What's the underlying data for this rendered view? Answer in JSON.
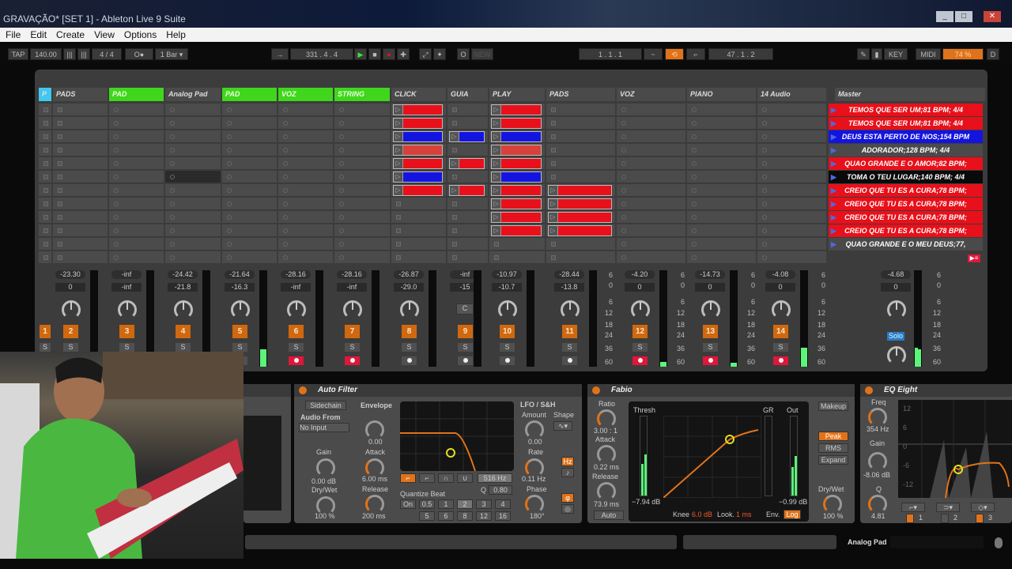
{
  "window": {
    "title": "GRAVAÇÃO*  [SET 1] - Ableton Live 9 Suite",
    "app_icon": "Live",
    "controls": [
      "_",
      "□",
      "✕"
    ]
  },
  "menu": [
    "File",
    "Edit",
    "Create",
    "View",
    "Options",
    "Help"
  ],
  "transport": {
    "tap": "TAP",
    "tempo": "140.00",
    "sig": "4  /  4",
    "metro": "O●",
    "quant": "1 Bar ▾",
    "follow": "→",
    "position": "331 .  4 .  4",
    "new": "NEW",
    "loop_start": "1 .  1 .  1",
    "loop_len": "47 .  1 .  2",
    "key": "KEY",
    "midi": "MIDI",
    "cpu": "74 %",
    "d": "D"
  },
  "tracks": [
    {
      "name": "P",
      "color": "#3fc8f0"
    },
    {
      "name": "PADS"
    },
    {
      "name": "PAD",
      "green": true
    },
    {
      "name": "Analog Pad"
    },
    {
      "name": "PAD",
      "green": true
    },
    {
      "name": "VOZ",
      "green": true
    },
    {
      "name": "STRING",
      "green": true
    },
    {
      "name": "CLICK"
    },
    {
      "name": "GUIA"
    },
    {
      "name": "PLAY"
    },
    {
      "name": "PADS"
    },
    {
      "name": "VOZ"
    },
    {
      "name": "PIANO"
    },
    {
      "name": "14 Audio"
    }
  ],
  "master_label": "Master",
  "clip_colors": {
    "r": "#e8101a",
    "b": "#1414e0",
    "l": "#d8403a"
  },
  "clips": {
    "7": [
      "r",
      "r",
      "b",
      "l",
      "r",
      "b",
      "r"
    ],
    "8": [
      "",
      "",
      "b",
      "",
      "r",
      "",
      "r"
    ],
    "9": [
      "r",
      "r",
      "b",
      "l",
      "r",
      "b",
      "r",
      "r",
      "r",
      "r"
    ],
    "10": [
      "",
      "",
      "",
      "",
      "",
      "",
      "r",
      "r",
      "r",
      "r"
    ]
  },
  "scenes": [
    {
      "name": "TEMOS QUE SER UM;81 BPM; 4/4",
      "color": "#e8101a"
    },
    {
      "name": "TEMOS QUE SER UM;81 BPM; 4/4",
      "color": "#e8101a"
    },
    {
      "name": "DEUS ESTA PERTO DE NOS;154 BPM",
      "color": "#1414e0"
    },
    {
      "name": "ADORADOR;128 BPM; 4/4",
      "color": "#4a4a4a"
    },
    {
      "name": "QUAO GRANDE E O AMOR;82 BPM;",
      "color": "#e8101a"
    },
    {
      "name": "TOMA O TEU LUGAR;140 BPM; 4/4",
      "color": "#0a0a0a"
    },
    {
      "name": "CREIO QUE TU ES A CURA;78 BPM;",
      "color": "#e8101a"
    },
    {
      "name": "CREIO QUE TU ES A CURA;78 BPM;",
      "color": "#e8101a"
    },
    {
      "name": "CREIO QUE TU ES A CURA;78 BPM;",
      "color": "#e8101a"
    },
    {
      "name": "CREIO QUE TU ES A CURA;78 BPM;",
      "color": "#e8101a"
    },
    {
      "name": "QUAO GRANDE  E O MEU DEUS;77,",
      "color": "#4a4a4a"
    }
  ],
  "mixer": [
    {
      "n": "1",
      "peak": "",
      "vol": "",
      "arm": false,
      "meter": 0
    },
    {
      "n": "2",
      "peak": "-23.30",
      "vol": "0",
      "arm": false,
      "meter": 0.1
    },
    {
      "n": "3",
      "peak": "-inf",
      "vol": "-inf",
      "arm": false,
      "meter": 0
    },
    {
      "n": "4",
      "peak": "-24.42",
      "vol": "-21.8",
      "arm": false,
      "meter": 0
    },
    {
      "n": "5",
      "peak": "-21.64",
      "vol": "-16.3",
      "arm": false,
      "meter": 0.18
    },
    {
      "n": "6",
      "peak": "-28.16",
      "vol": "-inf",
      "arm": true,
      "meter": 0
    },
    {
      "n": "7",
      "peak": "-28.16",
      "vol": "-inf",
      "arm": true,
      "meter": 0
    },
    {
      "n": "8",
      "peak": "-26.87",
      "vol": "-29.0",
      "arm": false,
      "meter": 0
    },
    {
      "n": "9",
      "peak": "-inf",
      "vol": "-15",
      "arm": false,
      "meter": 0,
      "pan": "C"
    },
    {
      "n": "10",
      "peak": "-10.97",
      "vol": "-10.7",
      "arm": false,
      "meter": 0
    },
    {
      "n": "11",
      "peak": "-28.44",
      "vol": "-13.8",
      "arm": false,
      "meter": 0
    },
    {
      "n": "12",
      "peak": "-4.20",
      "vol": "0",
      "arm": true,
      "meter": 0.05
    },
    {
      "n": "13",
      "peak": "-14.73",
      "vol": "0",
      "arm": true,
      "meter": 0.04
    },
    {
      "n": "14",
      "peak": "-4.08",
      "vol": "0",
      "arm": true,
      "meter": 0.2
    }
  ],
  "master": {
    "peak": "-4.68",
    "vol": "0",
    "solo": "Solo",
    "meter": 0.2
  },
  "solo_label": "S",
  "db_scale": [
    "6",
    "0",
    "6",
    "12",
    "18",
    "24",
    "36",
    "60"
  ],
  "devices": {
    "auto_filter": {
      "title": "Auto Filter",
      "sidechain": "Sidechain",
      "audio_from": "Audio From",
      "input": "No Input",
      "gain": "Gain",
      "gain_val": "0.00 dB",
      "drywet": "Dry/Wet",
      "drywet_val": "100 %",
      "envelope": "Envelope",
      "env_val": "0.00",
      "attack": "Attack",
      "attack_val": "6.00 ms",
      "release": "Release",
      "release_val": "200 ms",
      "freq": "516 Hz",
      "q": "Q",
      "q_val": "0.80",
      "quantize": "Quantize Beat",
      "qbtns": [
        "On",
        "0.5",
        "1",
        "2",
        "3",
        "4",
        "5",
        "6",
        "8",
        "12",
        "16"
      ],
      "lfo": "LFO / S&H",
      "amount": "Amount",
      "amount_val": "0.00",
      "shape": "Shape",
      "rate": "Rate",
      "rate_val": "0.11 Hz",
      "phase": "Phase",
      "phase_val": "180°",
      "hz": "Hz"
    },
    "compressor": {
      "title": "Fabio",
      "ratio": "Ratio",
      "ratio_val": "3.00 : 1",
      "attack": "Attack",
      "attack_val": "0.22 ms",
      "release": "Release",
      "release_val": "73.9 ms",
      "auto": "Auto",
      "thresh": "Thresh",
      "gr": "GR",
      "out": "Out",
      "thresh_val": "−7.94 dB",
      "out_val": "−0.99 dB",
      "makeup": "Makeup",
      "peak": "Peak",
      "rms": "RMS",
      "expand": "Expand",
      "drywet": "Dry/Wet",
      "drywet_val": "100 %",
      "knee": "Knee",
      "knee_val": "6.0 dB",
      "look": "Look.",
      "look_val": "1 ms",
      "env": "Env.",
      "env_val": "Log"
    },
    "eq": {
      "title": "EQ Eight",
      "freq": "Freq",
      "freq_val": "354 Hz",
      "gain": "Gain",
      "gain_val": "-8.06 dB",
      "q": "Q",
      "q_val": "4.81",
      "grid": [
        "12",
        "6",
        "0",
        "-6",
        "-12"
      ],
      "bands": [
        "1",
        "2",
        "3"
      ]
    }
  },
  "bottom": {
    "track_label": "Analog Pad"
  }
}
